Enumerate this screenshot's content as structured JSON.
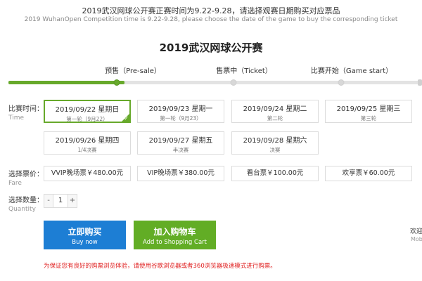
{
  "notice": {
    "cn": "2019武汉网球公开赛正赛时间为9.22-9.28，请选择观赛日期购买对应票品",
    "en": "2019 WuhanOpen Competition time is 9.22-9.28, please choose the date of the game to buy the corresponding ticket"
  },
  "event_title": "2019武汉网球公开赛",
  "progress": {
    "steps": [
      {
        "label": "预售（Pre-sale）",
        "active": true
      },
      {
        "label": "售票中（Ticket）",
        "active": false
      },
      {
        "label": "比赛开始（Game start）",
        "active": false
      }
    ],
    "fill_fraction": 0.28
  },
  "time_row": {
    "label_cn": "比赛时间：",
    "label_en": "Time",
    "dates": [
      {
        "main": "2019/09/22 星期日",
        "sub": "第一轮（9月22）",
        "selected": true
      },
      {
        "main": "2019/09/23 星期一",
        "sub": "第一轮（9月23）",
        "selected": false
      },
      {
        "main": "2019/09/24 星期二",
        "sub": "第二轮",
        "selected": false
      },
      {
        "main": "2019/09/25 星期三",
        "sub": "第三轮",
        "selected": false
      },
      {
        "main": "2019/09/26 星期四",
        "sub": "1/4决赛",
        "selected": false
      },
      {
        "main": "2019/09/27 星期五",
        "sub": "半决赛",
        "selected": false
      },
      {
        "main": "2019/09/28 星期六",
        "sub": "决赛",
        "selected": false
      }
    ]
  },
  "fare_row": {
    "label_cn": "选择票价：",
    "label_en": "Fare",
    "options": [
      {
        "label": "VVIP晚场票￥480.00元"
      },
      {
        "label": "VIP晚场票￥380.00元"
      },
      {
        "label": "看台票￥100.00元"
      },
      {
        "label": "欢享票￥60.00元"
      }
    ]
  },
  "qty_row": {
    "label_cn": "选择数量：",
    "label_en": "Quantity",
    "minus": "-",
    "value": "1",
    "plus": "+"
  },
  "actions": {
    "buy": {
      "main": "立即购买",
      "sub": "Buy now"
    },
    "cart": {
      "main": "加入购物车",
      "sub": "Add to Shopping Cart"
    }
  },
  "side": {
    "cn": "欢迎",
    "en": "Mob"
  },
  "warning": "为保证您有良好的购票浏览体验，请使用谷歌浏览器或者360浏览器极速模式进行购票。",
  "colors": {
    "accent_green": "#67a92b",
    "buy_blue": "#1d7ed4",
    "cart_green": "#62ad25",
    "warning_red": "#e02020"
  }
}
